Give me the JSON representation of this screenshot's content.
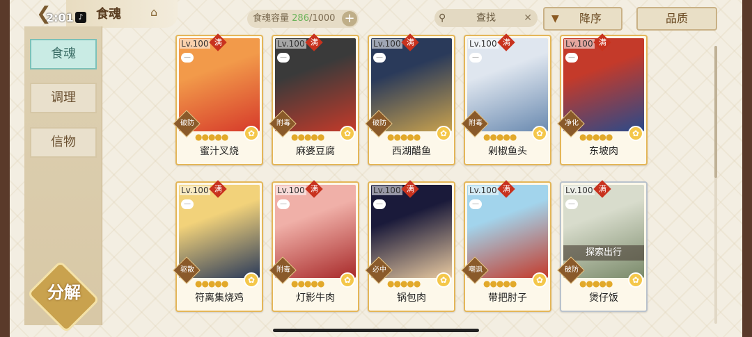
{
  "status": {
    "time": "2:01"
  },
  "header": {
    "title": "食魂",
    "capacity_label": "食魂容量",
    "capacity_current": "286",
    "capacity_total": "/1000",
    "search_placeholder": "查找",
    "sort_label": "降序",
    "filter_label": "品质"
  },
  "sidebar": {
    "tabs": [
      {
        "label": "食魂",
        "active": true
      },
      {
        "label": "调理",
        "active": false
      },
      {
        "label": "信物",
        "active": false
      }
    ],
    "decompose_label": "分解"
  },
  "cards": [
    {
      "level": "Lv.100",
      "badge": "满",
      "role": "破防",
      "name": "蜜汁叉烧",
      "stars": "●●●●●",
      "colors": [
        "#f29a4a",
        "#d63a2a"
      ],
      "tier": "gold"
    },
    {
      "level": "Lv.100",
      "badge": "满",
      "role": "附毒",
      "name": "麻婆豆腐",
      "stars": "●●●●●",
      "colors": [
        "#3a3a3a",
        "#c43a2a"
      ],
      "tier": "gold"
    },
    {
      "level": "Lv.100",
      "badge": "满",
      "role": "破防",
      "name": "西湖醋鱼",
      "stars": "●●●●●",
      "colors": [
        "#2a3a5a",
        "#c9a24e"
      ],
      "tier": "gold"
    },
    {
      "level": "Lv.100",
      "badge": "满",
      "role": "附毒",
      "name": "剁椒鱼头",
      "stars": "●●●●●",
      "colors": [
        "#dfe6ef",
        "#6a8ab0"
      ],
      "tier": "gold"
    },
    {
      "level": "Lv.100",
      "badge": "满",
      "role": "净化",
      "name": "东坡肉",
      "stars": "●●●●●",
      "colors": [
        "#c43a2a",
        "#2a4a8a"
      ],
      "tier": "gold"
    },
    {
      "level": "Lv.100",
      "badge": "满",
      "role": "驱散",
      "name": "符离集烧鸡",
      "stars": "●●●●●",
      "colors": [
        "#f2d27a",
        "#2a3a5a"
      ],
      "tier": "gold"
    },
    {
      "level": "Lv.100",
      "badge": "满",
      "role": "附毒",
      "name": "灯影牛肉",
      "stars": "●●●●●",
      "colors": [
        "#f0b0a8",
        "#a82a2a"
      ],
      "tier": "gold"
    },
    {
      "level": "Lv.100",
      "badge": "满",
      "role": "必中",
      "name": "锅包肉",
      "stars": "●●●●●",
      "colors": [
        "#1a1a3a",
        "#e8c9a0"
      ],
      "tier": "gold"
    },
    {
      "level": "Lv.100",
      "badge": "满",
      "role": "嘲讽",
      "name": "带把肘子",
      "stars": "●●●●●",
      "colors": [
        "#a2d4ec",
        "#c43a2a"
      ],
      "tier": "gold"
    },
    {
      "level": "Lv.100",
      "badge": "满",
      "role": "破防",
      "name": "煲仔饭",
      "stars": "●●●●●",
      "colors": [
        "#d8dccc",
        "#7a8a6a"
      ],
      "tier": "silver",
      "banner": "探索出行"
    }
  ]
}
